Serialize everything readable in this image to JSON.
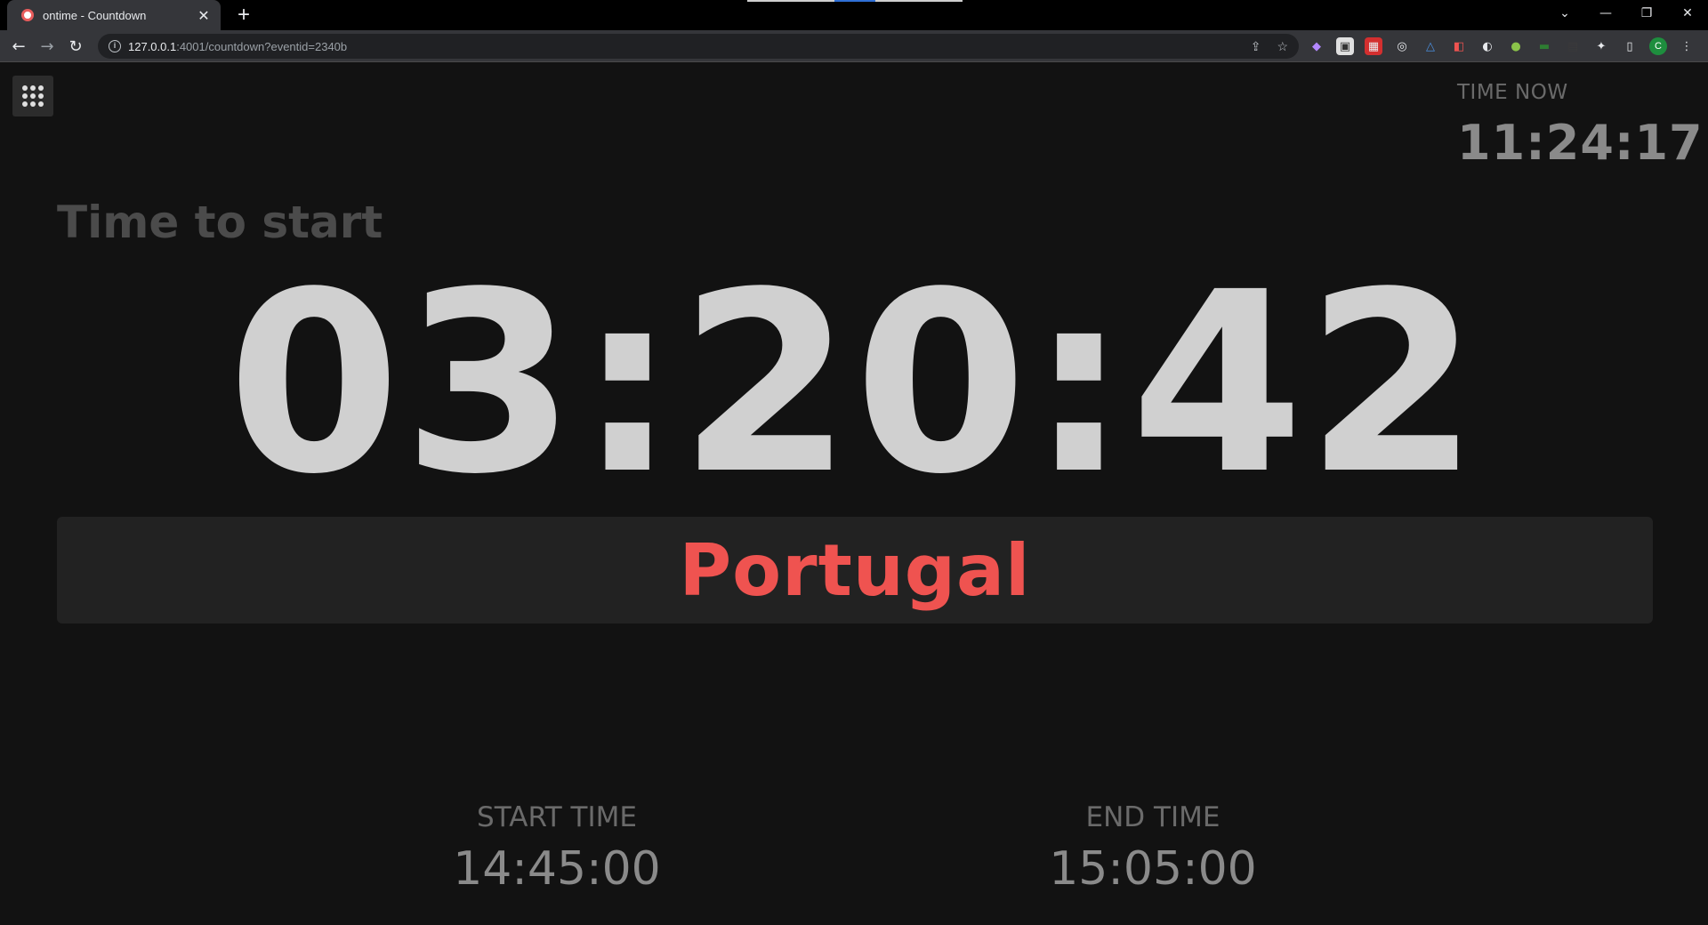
{
  "browser": {
    "tab_title": "ontime - Countdown",
    "url_host": "127.0.0.1",
    "url_rest": ":4001/countdown?eventid=2340b",
    "profile_initial": "C"
  },
  "page": {
    "clock_label": "TIME NOW",
    "clock_value": "11:24:17",
    "status_label": "Time to start",
    "timer": "03:20:42",
    "event_title": "Portugal",
    "start_label": "START TIME",
    "start_value": "14:45:00",
    "end_label": "END TIME",
    "end_value": "15:05:00"
  },
  "colors": {
    "background": "#121212",
    "timer": "#d0d0d0",
    "title_accent": "#ef5350",
    "title_box": "#222222"
  },
  "icons": [
    "menu-grid-icon",
    "back-icon",
    "forward-icon",
    "reload-icon",
    "info-icon",
    "share-icon",
    "star-icon",
    "extensions-icon",
    "side-panel-icon",
    "kebab-menu-icon"
  ]
}
